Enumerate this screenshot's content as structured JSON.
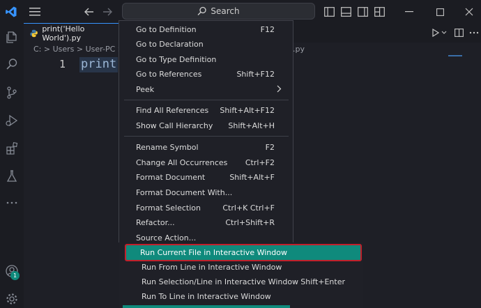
{
  "titlebar": {
    "search_label": "Search"
  },
  "activitybar": {
    "badge": "1"
  },
  "tab": {
    "title": "print('Hello World').py"
  },
  "breadcrumb": {
    "path": "C: > Users > User-PC > D",
    "tail": ".py"
  },
  "editor": {
    "line_number": "1",
    "code": "print"
  },
  "context_menu": {
    "items": [
      {
        "label": "Go to Definition",
        "shortcut": "F12"
      },
      {
        "label": "Go to Declaration",
        "shortcut": ""
      },
      {
        "label": "Go to Type Definition",
        "shortcut": ""
      },
      {
        "label": "Go to References",
        "shortcut": "Shift+F12"
      },
      {
        "label": "Peek",
        "shortcut": ""
      },
      {
        "label": "Find All References",
        "shortcut": "Shift+Alt+F12"
      },
      {
        "label": "Show Call Hierarchy",
        "shortcut": "Shift+Alt+H"
      },
      {
        "label": "Rename Symbol",
        "shortcut": "F2"
      },
      {
        "label": "Change All Occurrences",
        "shortcut": "Ctrl+F2"
      },
      {
        "label": "Format Document",
        "shortcut": "Shift+Alt+F"
      },
      {
        "label": "Format Document With...",
        "shortcut": ""
      },
      {
        "label": "Format Selection",
        "shortcut": "Ctrl+K Ctrl+F"
      },
      {
        "label": "Refactor...",
        "shortcut": "Ctrl+Shift+R"
      },
      {
        "label": "Source Action...",
        "shortcut": ""
      }
    ],
    "interactive": [
      {
        "label": "Run Current File in Interactive Window",
        "shortcut": ""
      },
      {
        "label": "Run From Line in Interactive Window",
        "shortcut": ""
      },
      {
        "label": "Run Selection/Line in Interactive Window",
        "shortcut": "Shift+Enter"
      },
      {
        "label": "Run To Line in Interactive Window",
        "shortcut": ""
      }
    ]
  },
  "colors": {
    "accent": "#0f8a7c",
    "highlight_border": "#c2202b",
    "vscode_blue": "#3794ff"
  }
}
